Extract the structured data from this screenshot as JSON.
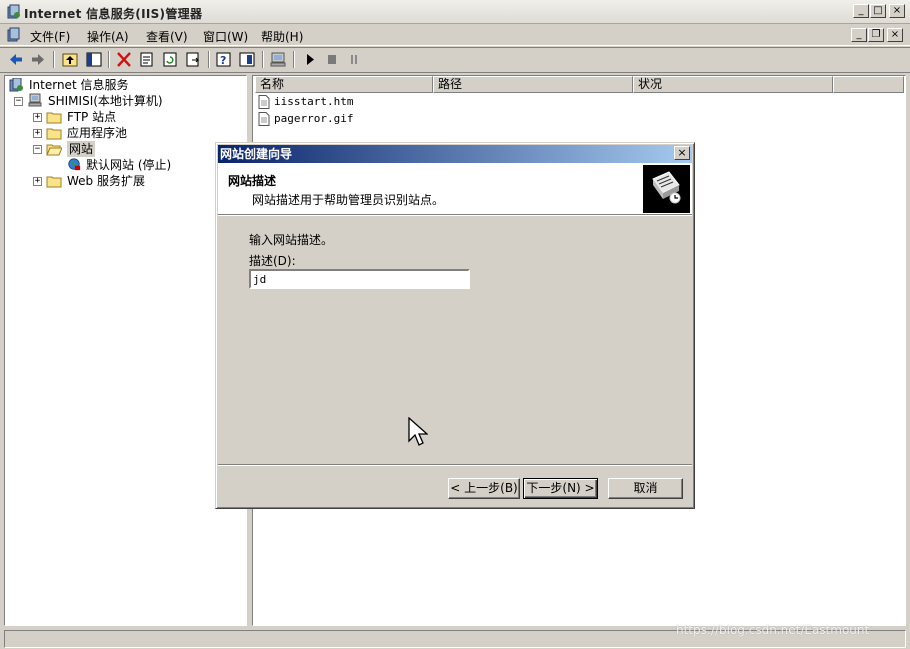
{
  "window": {
    "title": "Internet 信息服务(IIS)管理器",
    "minimize_label": "_",
    "maximize_label": "□",
    "close_label": "×",
    "mdi_minimize": "_",
    "mdi_restore": "❐",
    "mdi_close": "×"
  },
  "menu": [
    {
      "label": "文件(F)"
    },
    {
      "label": "操作(A)"
    },
    {
      "label": "查看(V)"
    },
    {
      "label": "窗口(W)"
    },
    {
      "label": "帮助(H)"
    }
  ],
  "tree": {
    "root": "Internet 信息服务",
    "server": "SHIMISI(本地计算机)",
    "items": [
      {
        "label": "FTP 站点"
      },
      {
        "label": "应用程序池"
      },
      {
        "label": "网站"
      },
      {
        "label": "默认网站 (停止)"
      },
      {
        "label": "Web 服务扩展"
      }
    ],
    "expand_plus": "+",
    "expand_minus": "−"
  },
  "list": {
    "columns": [
      {
        "label": "名称"
      },
      {
        "label": "路径"
      },
      {
        "label": "状况"
      }
    ],
    "rows": [
      {
        "name": "iisstart.htm"
      },
      {
        "name": "pagerror.gif"
      }
    ]
  },
  "dialog": {
    "title": "网站创建向导",
    "close_label": "×",
    "heading": "网站描述",
    "subheading": "网站描述用于帮助管理员识别站点。",
    "prompt": "输入网站描述。",
    "description_label": "描述(D):",
    "description_value": "jd",
    "back_button": "< 上一步(B)",
    "next_button": "下一步(N) >",
    "cancel_button": "取消"
  },
  "watermark": "https://blog.csdn.net/Eastmount"
}
